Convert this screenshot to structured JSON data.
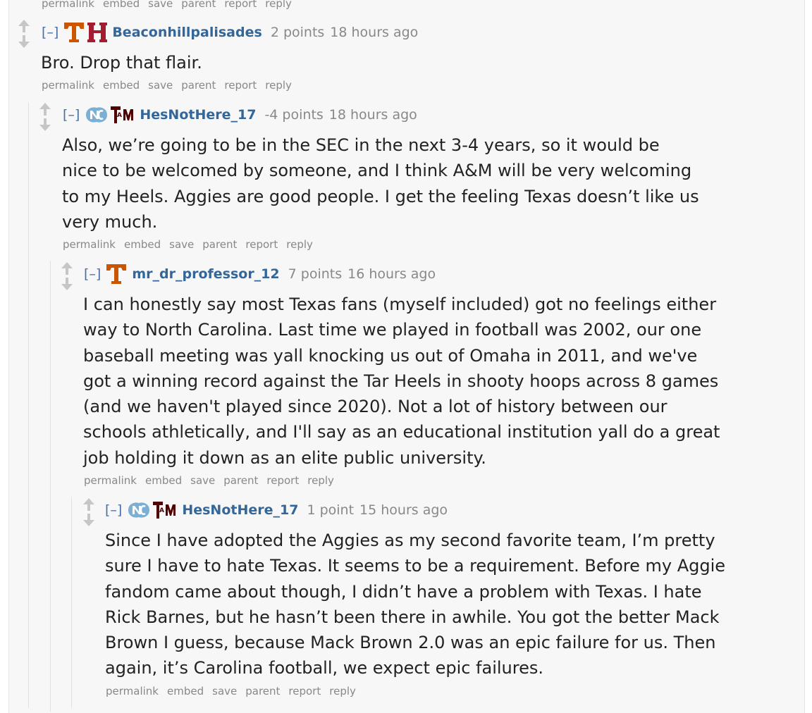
{
  "actions": [
    "permalink",
    "embed",
    "save",
    "parent",
    "report",
    "reply"
  ],
  "collapse_label": "[–]",
  "comments": [
    {
      "author": "Beaconhillpalisades",
      "score": "2 points",
      "time": "18 hours ago",
      "flairs": [
        "texas-flair-icon",
        "harvard-flair-icon"
      ],
      "body": [
        "Bro. Drop that flair."
      ]
    },
    {
      "author": "HesNotHere_17",
      "score": "-4 points",
      "time": "18 hours ago",
      "flairs": [
        "north-carolina-flair-icon",
        "texas-am-flair-icon"
      ],
      "body": [
        "Also, we’re going to be in the SEC in the next 3-4 years, so it would be",
        "nice to be welcomed by someone, and I think A&M will be very welcoming",
        "to my Heels. Aggies are good people. I get the feeling Texas doesn’t like us",
        "very much."
      ]
    },
    {
      "author": "mr_dr_professor_12",
      "score": "7 points",
      "time": "16 hours ago",
      "flairs": [
        "texas-flair-icon"
      ],
      "body": [
        "I can honestly say most Texas fans (myself included) got no feelings either",
        "way to North Carolina. Last time we played in football was 2002, our one",
        "baseball meeting was yall knocking us out of Omaha in 2011, and we've",
        "got a winning record against the Tar Heels in shooty hoops across 8 games",
        "(and we haven't played since 2020). Not a lot of history between our",
        "schools athletically, and I'll say as an educational institution yall do a great",
        "job holding it down as an elite public university."
      ]
    },
    {
      "author": "HesNotHere_17",
      "score": "1 point",
      "time": "15 hours ago",
      "flairs": [
        "north-carolina-flair-icon",
        "texas-am-flair-icon"
      ],
      "body": [
        "Since I have adopted the Aggies as my second favorite team, I’m pretty",
        "sure I have to hate Texas. It seems to be a requirement. Before my Aggie",
        "fandom came about though, I didn’t have a problem with Texas. I hate",
        "Rick Barnes, but he hasn’t been there in awhile. You got the better Mack",
        "Brown I guess, because Mack Brown 2.0 was an epic failure for us. Then",
        "again, it’s Carolina football, we expect epic failures."
      ]
    }
  ],
  "colors": {
    "author": "#336699",
    "texas_orange": "#cc5500",
    "harvard_crimson": "#a51c30",
    "carolina_blue": "#7bafd4",
    "aggie_maroon": "#500000"
  }
}
